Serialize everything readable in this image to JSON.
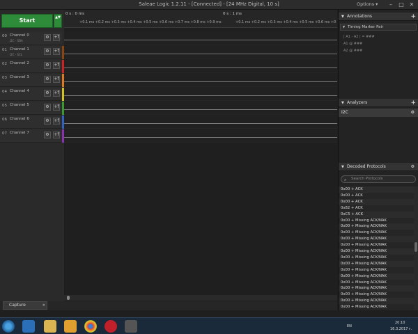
{
  "window": {
    "title": "Saleae Logic 1.2.11 - [Connected] - [24 MHz Digital, 10 s]",
    "options_label": "Options ▾",
    "minimize": "–",
    "maximize": "□",
    "close": "✕"
  },
  "start": {
    "label": "Start",
    "arrows": "▲▼"
  },
  "channels": [
    {
      "num": "00",
      "name": "Channel 0",
      "sub": "I2C - SDA",
      "color": "#2a2a2a"
    },
    {
      "num": "01",
      "name": "Channel 1",
      "sub": "I2C - SCL",
      "color": "#8b4513"
    },
    {
      "num": "02",
      "name": "Channel 2",
      "sub": "",
      "color": "#cc2222"
    },
    {
      "num": "03",
      "name": "Channel 3",
      "sub": "",
      "color": "#e07820"
    },
    {
      "num": "04",
      "name": "Channel 4",
      "sub": "",
      "color": "#d4c020"
    },
    {
      "num": "05",
      "name": "Channel 5",
      "sub": "",
      "color": "#3a9a30"
    },
    {
      "num": "06",
      "name": "Channel 6",
      "sub": "",
      "color": "#3060c0"
    },
    {
      "num": "07",
      "name": "Channel 7",
      "sub": "",
      "color": "#8a30b0"
    }
  ],
  "channel_buttons": {
    "gear": "⚙",
    "f": "+f"
  },
  "ruler": {
    "mark0": "0 s : 0 ms",
    "mark1": "0 s : 1 ms",
    "sub0": "+0.1 ms +0.2 ms +0.3 ms +0.4 ms +0.5 ms +0.6 ms +0.7 ms +0.8 ms +0.9 ms",
    "sub1": "+0.1 ms +0.2 ms +0.3 ms +0.4 ms +0.5 ms +0.6 ms +0"
  },
  "capture_tab": {
    "label": "Capture",
    "expand": "»"
  },
  "annotations": {
    "title": "Annotations",
    "timing_marker": "Timing Marker Pair",
    "formula": "| A1 - A2 | = ###",
    "a1": "A1  @  ###",
    "a2": "A2  @  ###"
  },
  "analyzers": {
    "title": "Analyzers",
    "items": [
      "I2C"
    ]
  },
  "decoded": {
    "title": "Decoded Protocols",
    "search_placeholder": "Search Protocols",
    "rows": [
      "0x00 + ACK",
      "0x00 + ACK",
      "0x00 + ACK",
      "0x82 + ACK",
      "0xC5 + ACK",
      "0x00 + Missing ACK/NAK",
      "0x00 + Missing ACK/NAK",
      "0x00 + Missing ACK/NAK",
      "0x00 + Missing ACK/NAK",
      "0x00 + Missing ACK/NAK",
      "0x00 + Missing ACK/NAK",
      "0x00 + Missing ACK/NAK",
      "0x00 + Missing ACK/NAK",
      "0x00 + Missing ACK/NAK",
      "0x00 + Missing ACK/NAK",
      "0x00 + Missing ACK/NAK",
      "0x00 + Missing ACK/NAK",
      "0x00 + Missing ACK/NAK",
      "0x00 + Missing ACK/NAK",
      "0x00 + Missing ACK/NAK"
    ]
  },
  "taskbar": {
    "lang": "EN",
    "time": "20:10",
    "date": "16.3.2017 г."
  }
}
